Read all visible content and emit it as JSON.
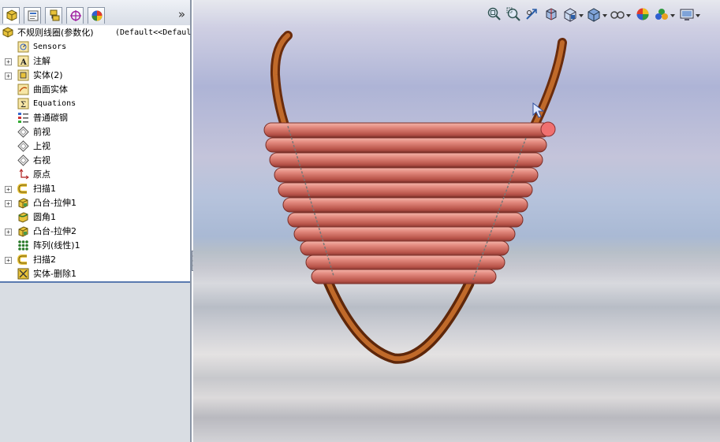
{
  "feature_manager": {
    "tabs": [
      {
        "name": "featuremanager-tree-icon",
        "active": true
      },
      {
        "name": "propertymanager-icon",
        "active": false
      },
      {
        "name": "configurationmanager-icon",
        "active": false
      },
      {
        "name": "dimxpert-icon",
        "active": false
      },
      {
        "name": "displaymanager-icon",
        "active": false
      }
    ],
    "more_label": "»",
    "root": {
      "label": "不规则线圈(参数化)",
      "config": "(Default<<Defaul"
    },
    "items": [
      {
        "label": "Sensors",
        "icon": "sensors-icon",
        "expandable": false
      },
      {
        "label": "注解",
        "icon": "annotations-icon",
        "expandable": true
      },
      {
        "label": "实体(2)",
        "icon": "solid-bodies-icon",
        "expandable": true
      },
      {
        "label": "曲面实体",
        "icon": "surface-bodies-icon",
        "expandable": false
      },
      {
        "label": "Equations",
        "icon": "equations-icon",
        "expandable": false
      },
      {
        "label": "普通碳钢",
        "icon": "material-icon",
        "expandable": false
      },
      {
        "label": "前视",
        "icon": "plane-icon",
        "expandable": false
      },
      {
        "label": "上视",
        "icon": "plane-icon",
        "expandable": false
      },
      {
        "label": "右视",
        "icon": "plane-icon",
        "expandable": false
      },
      {
        "label": "原点",
        "icon": "origin-icon",
        "expandable": false
      },
      {
        "label": "扫描1",
        "icon": "sweep-icon",
        "expandable": true
      },
      {
        "label": "凸台-拉伸1",
        "icon": "boss-extrude-icon",
        "expandable": true
      },
      {
        "label": "圆角1",
        "icon": "fillet-icon",
        "expandable": false
      },
      {
        "label": "凸台-拉伸2",
        "icon": "boss-extrude-icon",
        "expandable": true
      },
      {
        "label": "阵列(线性)1",
        "icon": "linear-pattern-icon",
        "expandable": false
      },
      {
        "label": "扫描2",
        "icon": "sweep-icon",
        "expandable": true
      },
      {
        "label": "实体-删除1",
        "icon": "delete-body-icon",
        "expandable": false
      }
    ]
  },
  "view_toolbar": [
    {
      "name": "zoom-to-fit-icon",
      "dropdown": false
    },
    {
      "name": "zoom-to-area-icon",
      "dropdown": false
    },
    {
      "name": "previous-view-icon",
      "dropdown": false
    },
    {
      "name": "section-view-icon",
      "dropdown": false
    },
    {
      "name": "view-orientation-icon",
      "dropdown": true
    },
    {
      "name": "display-style-icon",
      "dropdown": true
    },
    {
      "name": "hide-show-items-icon",
      "dropdown": true
    },
    {
      "name": "edit-appearance-icon",
      "dropdown": false
    },
    {
      "name": "apply-scene-icon",
      "dropdown": true
    },
    {
      "name": "view-settings-icon",
      "dropdown": true
    }
  ],
  "colors": {
    "coil": "#e0857a",
    "coil_shadow": "#a4463e",
    "wire": "#a9541d",
    "panel_bg": "#d9dde3",
    "tree_bg": "#ffffff",
    "selection_point": "#f07070"
  }
}
